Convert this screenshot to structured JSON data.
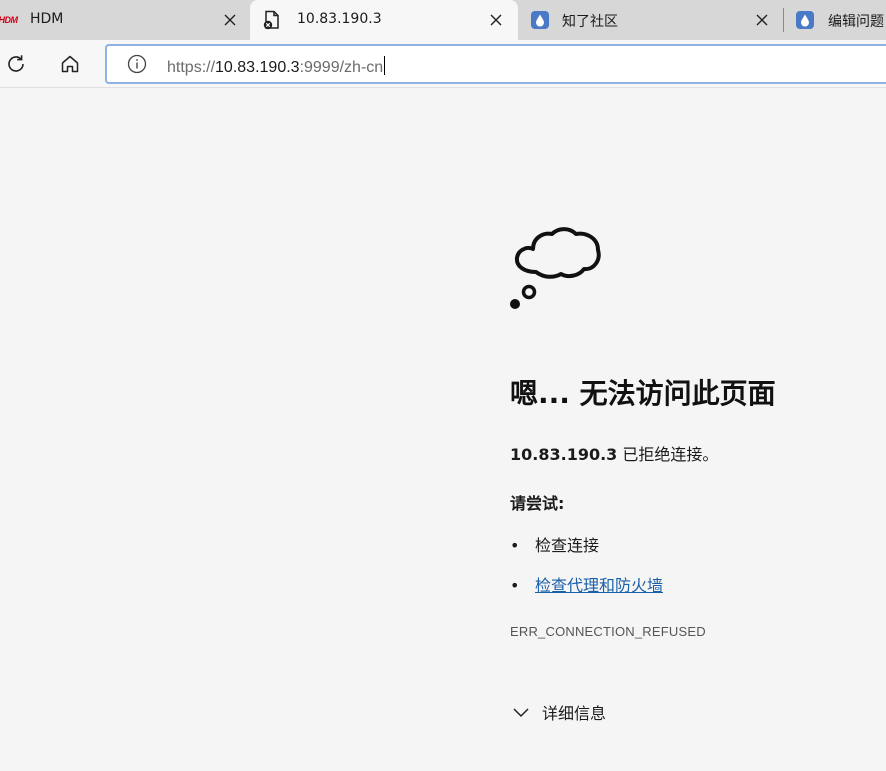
{
  "tabs": [
    {
      "title": "HDM",
      "favicon": "hdm-logo-icon",
      "favicon_text": "HDM",
      "active": false
    },
    {
      "title": "10.83.190.3",
      "favicon": "broken-page-icon",
      "active": true
    },
    {
      "title": "知了社区",
      "favicon": "drop-icon",
      "active": false
    },
    {
      "title": "编辑问题",
      "favicon": "drop-icon",
      "active": false
    }
  ],
  "toolbar": {
    "reload_icon": "reload-icon",
    "home_icon": "home-icon"
  },
  "omnibox": {
    "scheme": "https://",
    "host": "10.83.190.3",
    "rest": ":9999/zh-cn",
    "info_icon": "info-icon"
  },
  "error_page": {
    "heading": "嗯... 无法访问此页面",
    "host": "10.83.190.3",
    "message": " 已拒绝连接。",
    "try_label": "请尝试:",
    "suggestions": [
      {
        "bullet": "•",
        "text": "检查连接",
        "link": false
      },
      {
        "bullet": "•",
        "text": "检查代理和防火墙",
        "link": true
      }
    ],
    "error_code": "ERR_CONNECTION_REFUSED",
    "details_label": "详细信息"
  },
  "colors": {
    "link": "#1a5fa8",
    "tabstrip_bg": "#d7d7d7",
    "page_bg": "#f5f5f5",
    "omnibox_border": "#8fb3e3"
  }
}
